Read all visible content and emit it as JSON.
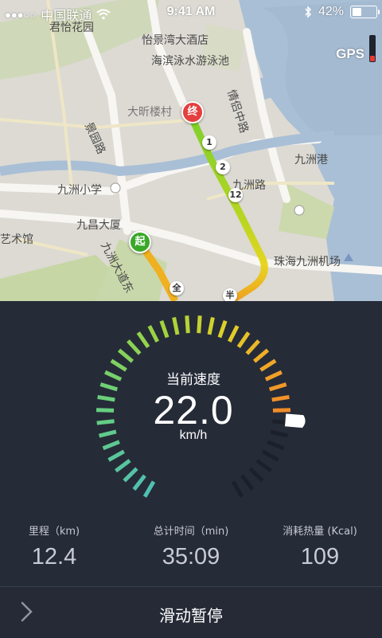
{
  "status_bar": {
    "signal": "●●●○○",
    "carrier": "中国联通",
    "time": "9:41 AM",
    "battery": "42%",
    "battery_level": 0.42
  },
  "map": {
    "gps_label": "GPS",
    "gps_strength": 0.22,
    "places": [
      "君怡花园",
      "怡景湾大酒店",
      "海滨泳水游泳池",
      "情侣中路",
      "九洲港",
      "景园路",
      "大昕楼村",
      "九洲小学",
      "九洲路",
      "九昌大厦",
      "艺术馆",
      "九洲大道东",
      "珠海九洲机场"
    ],
    "pin_start": "起",
    "pin_end": "终",
    "km_markers": [
      "1",
      "2",
      "12"
    ],
    "half_marker": "半",
    "full_marker": "全"
  },
  "speedometer": {
    "label": "当前速度",
    "value": "22.0",
    "unit": "km/h"
  },
  "stats": [
    {
      "label": "里程（km)",
      "value": "12.4"
    },
    {
      "label": "总计时间（min)",
      "value": "35:09"
    },
    {
      "label": "消耗热量 (Kcal)",
      "value": "109"
    }
  ],
  "slider": {
    "label": "滑动暂停"
  },
  "colors": {
    "panel_bg": "#262b38",
    "route_gradient": [
      "#7fd02b",
      "#e7d521",
      "#f0a020"
    ],
    "pin_start": "#3aa829",
    "pin_end": "#e53e3e"
  }
}
